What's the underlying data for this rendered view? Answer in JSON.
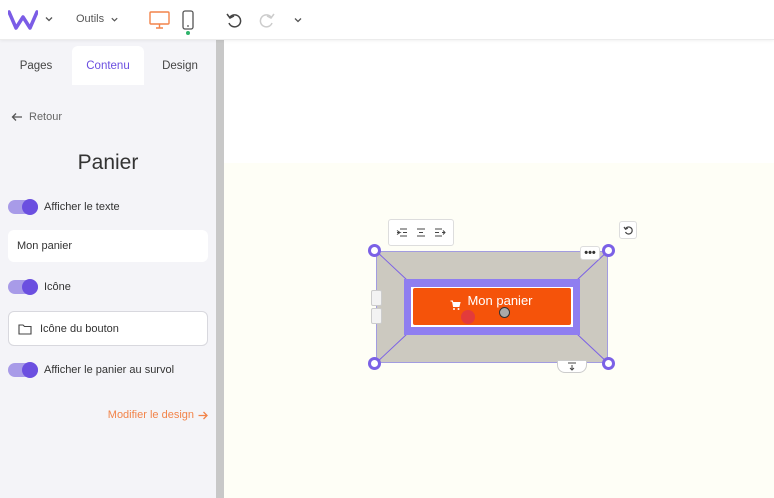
{
  "topbar": {
    "outils_label": "Outils"
  },
  "tabs": [
    {
      "label": "Pages"
    },
    {
      "label": "Contenu"
    },
    {
      "label": "Design"
    }
  ],
  "panel": {
    "back_label": "Retour",
    "title": "Panier",
    "toggle_text_label": "Afficher le texte",
    "text_value": "Mon panier",
    "toggle_icon_label": "Icône",
    "icon_field_label": "Icône du bouton",
    "toggle_hover_label": "Afficher le panier au survol",
    "modify_design_label": "Modifier le design"
  },
  "canvas": {
    "button_text": "Mon panier"
  },
  "colors": {
    "accent": "#6b4fe0",
    "button": "#f5530a",
    "link": "#f2844a"
  }
}
